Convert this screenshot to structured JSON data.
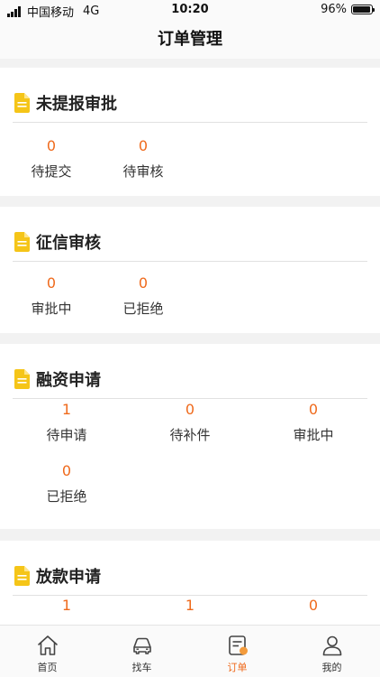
{
  "status_bar": {
    "carrier": "中国移动",
    "network": "4G",
    "time": "10:20",
    "battery_percent": "96%",
    "battery_level": 0.96
  },
  "header": {
    "title": "订单管理"
  },
  "accent_color": "#ef6a1c",
  "icon_color": "#f5c518",
  "sections": [
    {
      "title": "未提报审批",
      "icon": "document-icon",
      "items": [
        {
          "count": "0",
          "label": "待提交"
        },
        {
          "count": "0",
          "label": "待审核"
        }
      ]
    },
    {
      "title": "征信审核",
      "icon": "document-icon",
      "items": [
        {
          "count": "0",
          "label": "审批中"
        },
        {
          "count": "0",
          "label": "已拒绝"
        }
      ]
    },
    {
      "title": "融资申请",
      "icon": "document-icon",
      "items": [
        {
          "count": "1",
          "label": "待申请"
        },
        {
          "count": "0",
          "label": "待补件"
        },
        {
          "count": "0",
          "label": "审批中"
        },
        {
          "count": "0",
          "label": "已拒绝"
        }
      ]
    },
    {
      "title": "放款申请",
      "icon": "document-icon",
      "items": [
        {
          "count": "1",
          "label": ""
        },
        {
          "count": "1",
          "label": ""
        },
        {
          "count": "0",
          "label": ""
        }
      ]
    }
  ],
  "tab_bar": [
    {
      "label": "首页",
      "icon": "home-icon",
      "active": false
    },
    {
      "label": "找车",
      "icon": "car-icon",
      "active": false
    },
    {
      "label": "订单",
      "icon": "order-icon",
      "active": true
    },
    {
      "label": "我的",
      "icon": "profile-icon",
      "active": false
    }
  ]
}
